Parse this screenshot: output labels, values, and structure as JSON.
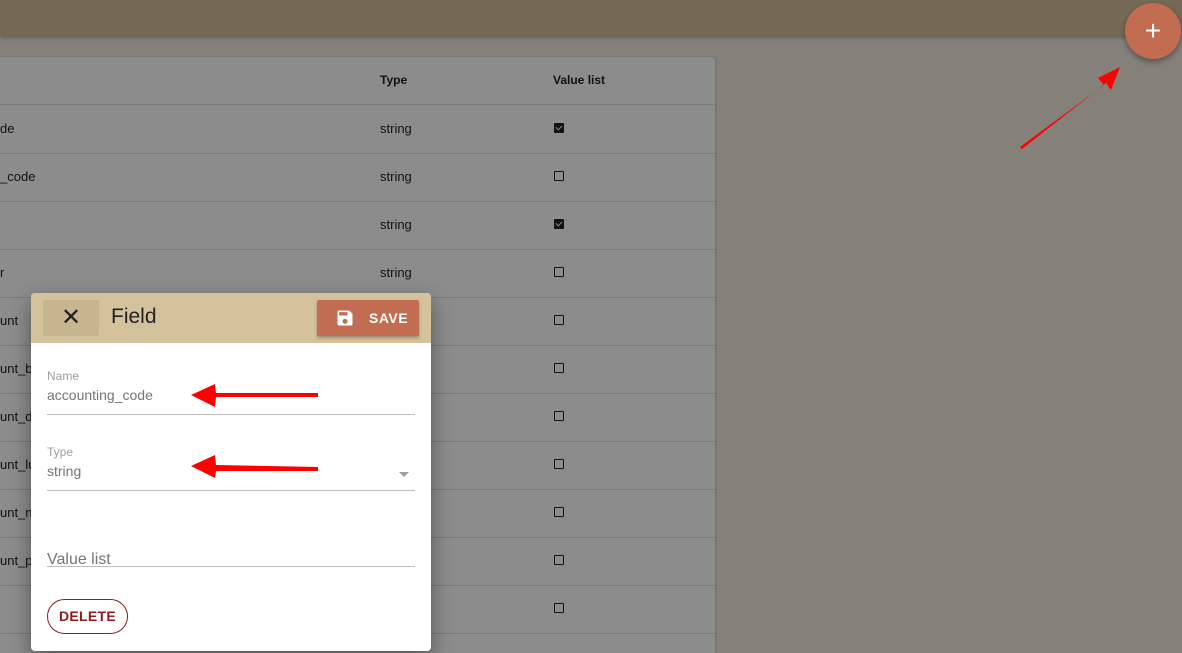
{
  "fab": {
    "icon": "plus-icon",
    "glyph": "+"
  },
  "table": {
    "headers": {
      "type": "Type",
      "value_list": "Value list"
    },
    "rows": [
      {
        "name": "de",
        "type": "string",
        "value_list": true
      },
      {
        "name": "_code",
        "type": "string",
        "value_list": false
      },
      {
        "name": "",
        "type": "string",
        "value_list": true
      },
      {
        "name": "r",
        "type": "string",
        "value_list": false
      },
      {
        "name": "unt",
        "type": "",
        "value_list": false
      },
      {
        "name": "unt_b",
        "type": "",
        "value_list": false
      },
      {
        "name": "unt_d",
        "type": "",
        "value_list": false
      },
      {
        "name": "unt_lu",
        "type": "",
        "value_list": false
      },
      {
        "name": "unt_n",
        "type": "",
        "value_list": false
      },
      {
        "name": "unt_p",
        "type": "",
        "value_list": false
      },
      {
        "name": "",
        "type": "",
        "value_list": false
      }
    ]
  },
  "dialog": {
    "title": "Field",
    "close_icon": "close-icon",
    "close_glyph": "✕",
    "save_icon": "floppy-disk-icon",
    "save_label": "SAVE",
    "fields": {
      "name": {
        "label": "Name",
        "value": "accounting_code"
      },
      "type": {
        "label": "Type",
        "value": "string"
      },
      "value_list": {
        "placeholder": "Value list"
      }
    },
    "delete_label": "DELETE"
  },
  "colors": {
    "accent": "#c26d52",
    "header_tan": "#d4c29c",
    "danger": "#8b1d1d",
    "annotation_arrow": "#ff0000"
  }
}
